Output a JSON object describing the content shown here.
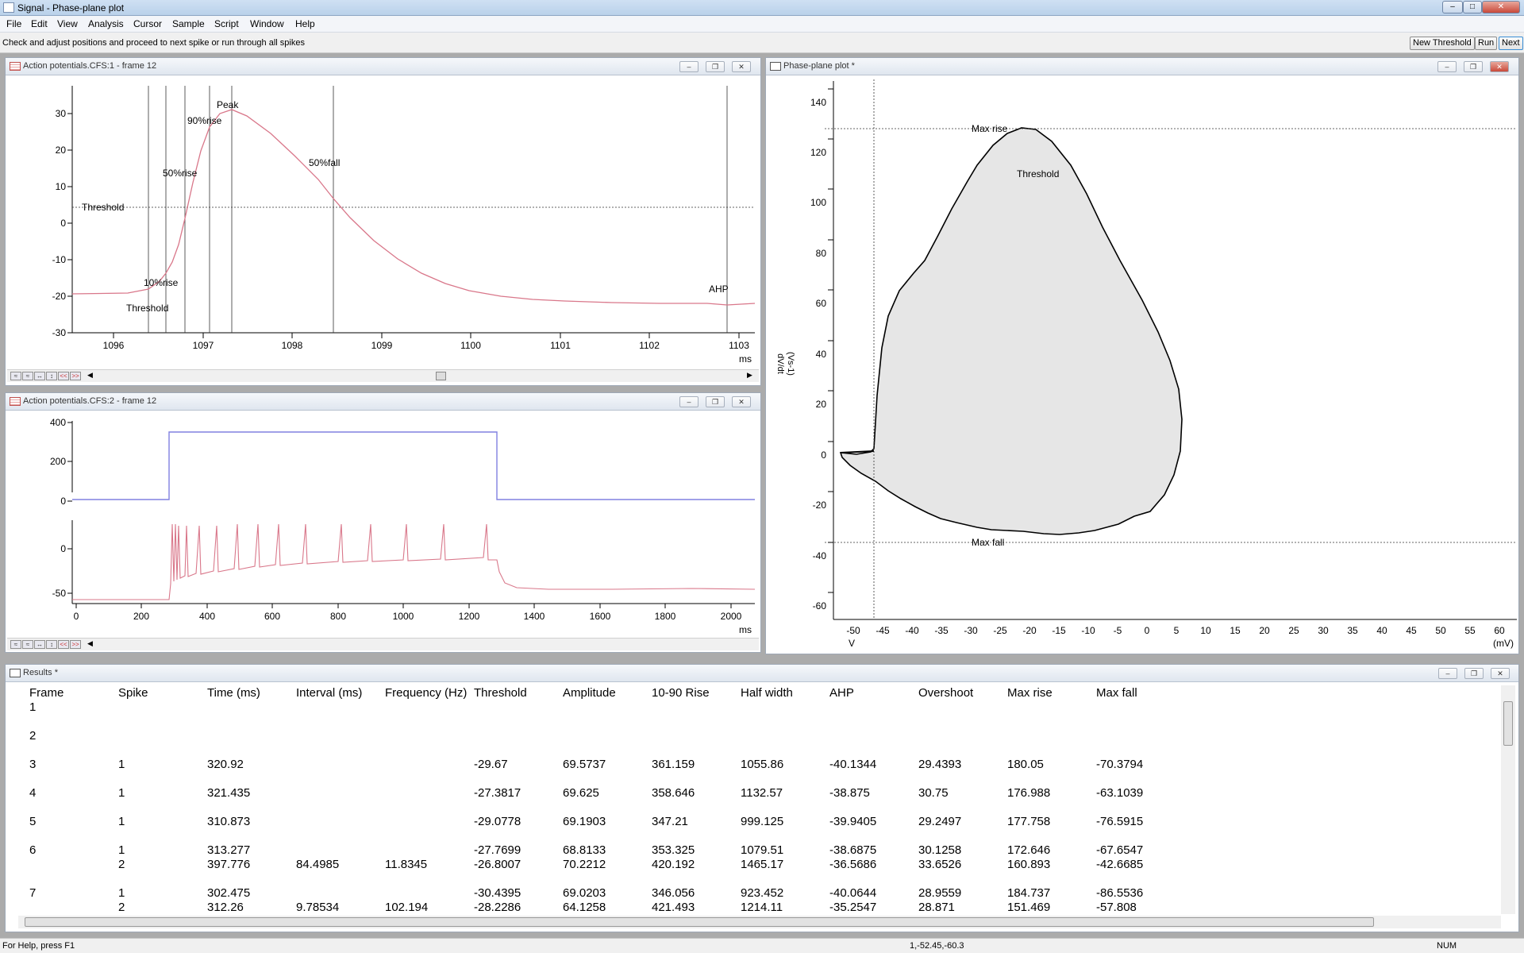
{
  "app": {
    "title": "Signal - Phase-plane plot"
  },
  "menu": [
    "File",
    "Edit",
    "View",
    "Analysis",
    "Cursor",
    "Sample",
    "Script",
    "Window",
    "Help"
  ],
  "toolbar": {
    "message": "Check and adjust positions and proceed to next spike or run through all spikes",
    "new_threshold": "New Threshold",
    "run": "Run",
    "next": "Next"
  },
  "win1": {
    "title": "Action potentials.CFS:1 - frame 12",
    "xunit": "ms",
    "xticks": [
      "1096",
      "1097",
      "1098",
      "1099",
      "1100",
      "1101",
      "1102",
      "1103"
    ],
    "yticks": [
      "30",
      "20",
      "10",
      "0",
      "-10",
      "-20",
      "-30"
    ],
    "cursors": {
      "threshold_h": "Threshold",
      "threshold_v": "Threshold",
      "r10": "10%rise",
      "r50": "50%rise",
      "r90": "90%rise",
      "peak": "Peak",
      "fall50": "50%fall",
      "ahp": "AHP"
    }
  },
  "win2": {
    "title": "Action potentials.CFS:2 - frame 12",
    "xunit": "ms",
    "xticks": [
      "0",
      "200",
      "400",
      "600",
      "800",
      "1000",
      "1200",
      "1400",
      "1600",
      "1800",
      "2000"
    ],
    "yticks_top": [
      "400",
      "200",
      "0"
    ],
    "yticks_bottom": [
      "0",
      "-50"
    ]
  },
  "win3": {
    "title": "Phase-plane plot *",
    "ylabel": "dV/dt",
    "yunit": "(Vs-1)",
    "xunit_left": "V",
    "xunit_right": "(mV)",
    "xticks": [
      "-50",
      "-45",
      "-40",
      "-35",
      "-30",
      "-25",
      "-20",
      "-15",
      "-10",
      "-5",
      "0",
      "5",
      "10",
      "15",
      "20",
      "25",
      "30",
      "35",
      "40",
      "45",
      "50",
      "55",
      "60"
    ],
    "yticks": [
      "140",
      "120",
      "100",
      "80",
      "60",
      "40",
      "20",
      "0",
      "-20",
      "-40",
      "-60"
    ],
    "cursors": {
      "max_rise": "Max rise",
      "threshold": "Threshold",
      "max_fall": "Max fall"
    }
  },
  "results": {
    "title": "Results *",
    "headers": [
      "Frame",
      "Spike",
      "Time (ms)",
      "Interval (ms)",
      "Frequency (Hz)",
      "Threshold",
      "Amplitude",
      "10-90 Rise",
      "Half width",
      "AHP",
      "Overshoot",
      "Max rise",
      "Max fall"
    ],
    "rows": [
      [
        "1",
        "",
        "",
        "",
        "",
        "",
        "",
        "",
        "",
        "",
        "",
        "",
        ""
      ],
      [
        "2",
        "",
        "",
        "",
        "",
        "",
        "",
        "",
        "",
        "",
        "",
        "",
        ""
      ],
      [
        "3",
        "1",
        "320.92",
        "",
        "",
        "-29.67",
        "69.5737",
        "361.159",
        "1055.86",
        "-40.1344",
        "29.4393",
        "180.05",
        "-70.3794"
      ],
      [
        "4",
        "1",
        "321.435",
        "",
        "",
        "-27.3817",
        "69.625",
        "358.646",
        "1132.57",
        "-38.875",
        "30.75",
        "176.988",
        "-63.1039"
      ],
      [
        "5",
        "1",
        "310.873",
        "",
        "",
        "-29.0778",
        "69.1903",
        "347.21",
        "999.125",
        "-39.9405",
        "29.2497",
        "177.758",
        "-76.5915"
      ],
      [
        "6",
        "1",
        "313.277",
        "",
        "",
        "-27.7699",
        "68.8133",
        "353.325",
        "1079.51",
        "-38.6875",
        "30.1258",
        "172.646",
        "-67.6547"
      ],
      [
        "",
        "2",
        "397.776",
        "84.4985",
        "11.8345",
        "-26.8007",
        "70.2212",
        "420.192",
        "1465.17",
        "-36.5686",
        "33.6526",
        "160.893",
        "-42.6685"
      ],
      [
        "7",
        "1",
        "302.475",
        "",
        "",
        "-30.4395",
        "69.0203",
        "346.056",
        "923.452",
        "-40.0644",
        "28.9559",
        "184.737",
        "-86.5536"
      ],
      [
        "",
        "2",
        "312.26",
        "9.78534",
        "102.194",
        "-28.2286",
        "64.1258",
        "421.493",
        "1214.11",
        "-35.2547",
        "28.871",
        "151.469",
        "-57.808"
      ]
    ]
  },
  "statusbar": {
    "help": "For Help, press F1",
    "coords": "1,-52.45,-60.3",
    "num": "NUM"
  },
  "colors": {
    "trace_red": "#d9778a",
    "trace_blue": "#8080e0",
    "loop_fill": "#e6e6e6"
  }
}
